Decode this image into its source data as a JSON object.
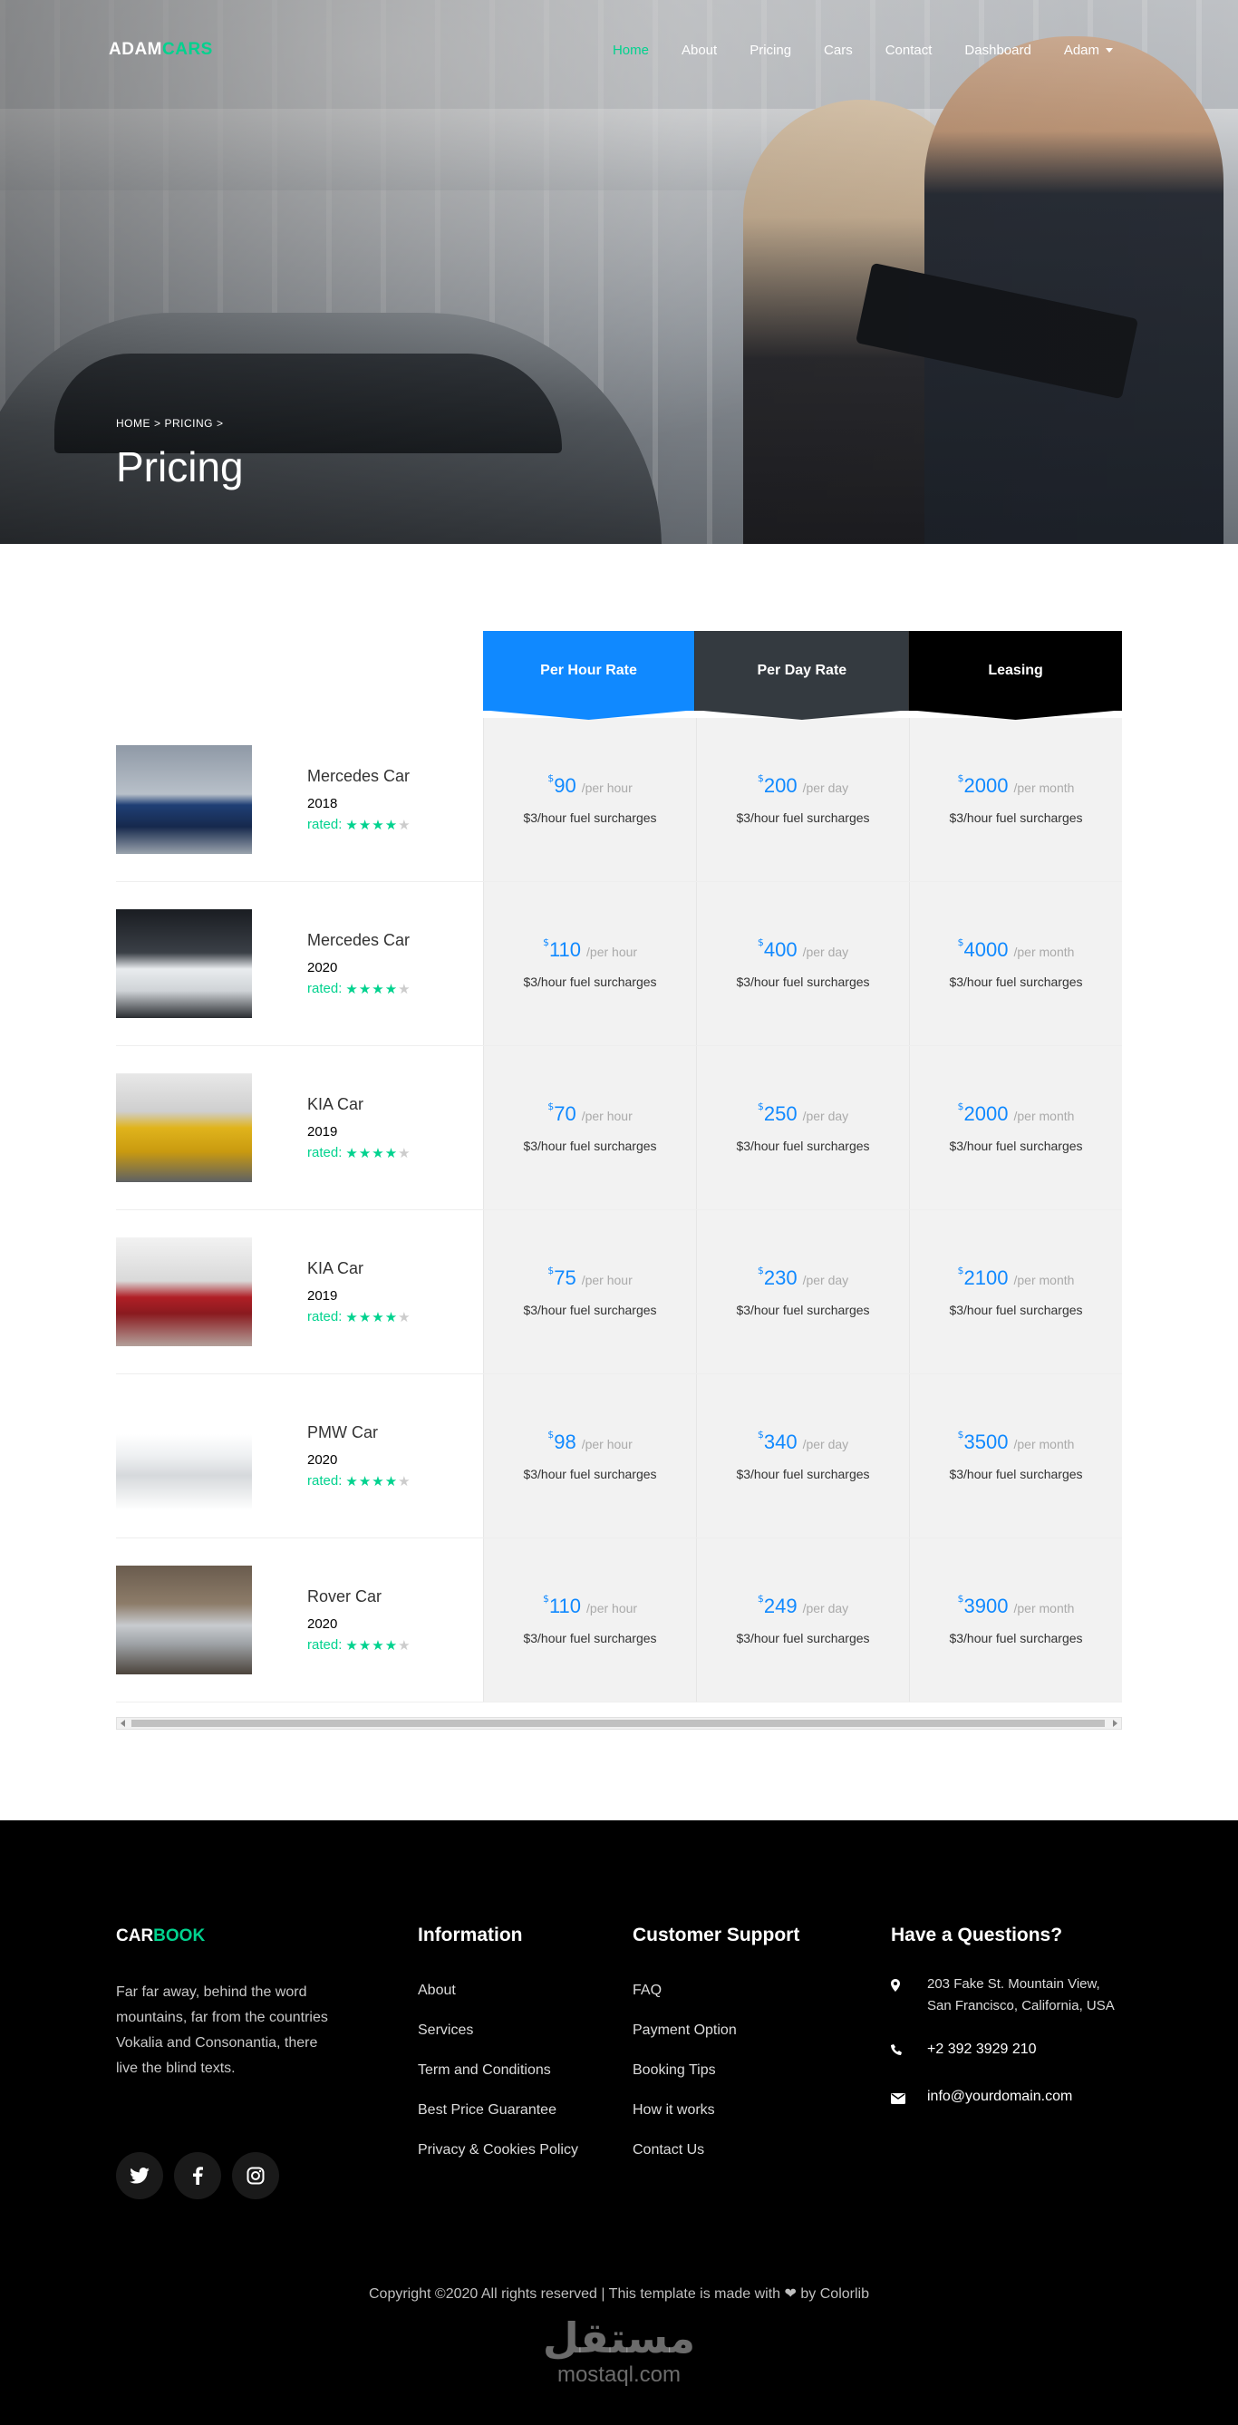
{
  "nav": {
    "brand_white": "ADAM",
    "brand_green": "CARS",
    "links": [
      "Home",
      "About",
      "Pricing",
      "Cars",
      "Contact",
      "Dashboard",
      "Adam"
    ],
    "active_index": 0
  },
  "hero": {
    "breadcrumb": [
      "HOME",
      "PRICING"
    ],
    "separator": ">",
    "title": "Pricing"
  },
  "pricing": {
    "headers": [
      "Per Hour Rate",
      "Per Day Rate",
      "Leasing"
    ],
    "rated_label": "rated:",
    "rating": 4,
    "rating_max": 5,
    "currency": "$",
    "per_hour": "/per hour",
    "per_day": "/per day",
    "per_month": "/per month",
    "fuel": "$3/hour fuel surcharges",
    "rows": [
      {
        "name": "Mercedes Car",
        "year": "2018",
        "hour": "90",
        "day": "200",
        "month": "2000",
        "thumb": "blue-mercedes"
      },
      {
        "name": "Mercedes Car",
        "year": "2020",
        "hour": "110",
        "day": "400",
        "month": "4000",
        "thumb": "white-mercedes-suv"
      },
      {
        "name": "KIA Car",
        "year": "2019",
        "hour": "70",
        "day": "250",
        "month": "2000",
        "thumb": "yellow-kia"
      },
      {
        "name": "KIA Car",
        "year": "2019",
        "hour": "75",
        "day": "230",
        "month": "2100",
        "thumb": "red-kia"
      },
      {
        "name": "PMW Car",
        "year": "2020",
        "hour": "98",
        "day": "340",
        "month": "3500",
        "thumb": "white-bmw"
      },
      {
        "name": "Rover Car",
        "year": "2020",
        "hour": "110",
        "day": "249",
        "month": "3900",
        "thumb": "silver-rover"
      }
    ]
  },
  "footer": {
    "brand_white": "CAR",
    "brand_green": "BOOK",
    "description": "Far far away, behind the word mountains, far from the countries Vokalia and Consonantia, there live the blind texts.",
    "socials": [
      "twitter-icon",
      "facebook-icon",
      "instagram-icon"
    ],
    "info_heading": "Information",
    "info_links": [
      "About",
      "Services",
      "Term and Conditions",
      "Best Price Guarantee",
      "Privacy & Cookies Policy"
    ],
    "support_heading": "Customer Support",
    "support_links": [
      "FAQ",
      "Payment Option",
      "Booking Tips",
      "How it works",
      "Contact Us"
    ],
    "questions_heading": "Have a Questions?",
    "address": "203 Fake St. Mountain View, San Francisco, California, USA",
    "phone": "+2 392 3929 210",
    "email": "info@yourdomain.com",
    "copyright_prefix": "Copyright ©2020 All rights reserved | This template is made with",
    "copyright_suffix": "by Colorlib",
    "watermark_ar": "مستقل",
    "watermark_en": "mostaql.com"
  },
  "colors": {
    "accent_green": "#01d28e",
    "accent_blue": "#1089ff",
    "dark": "#343a40",
    "black": "#000000",
    "cell_bg": "#f2f2f2"
  }
}
